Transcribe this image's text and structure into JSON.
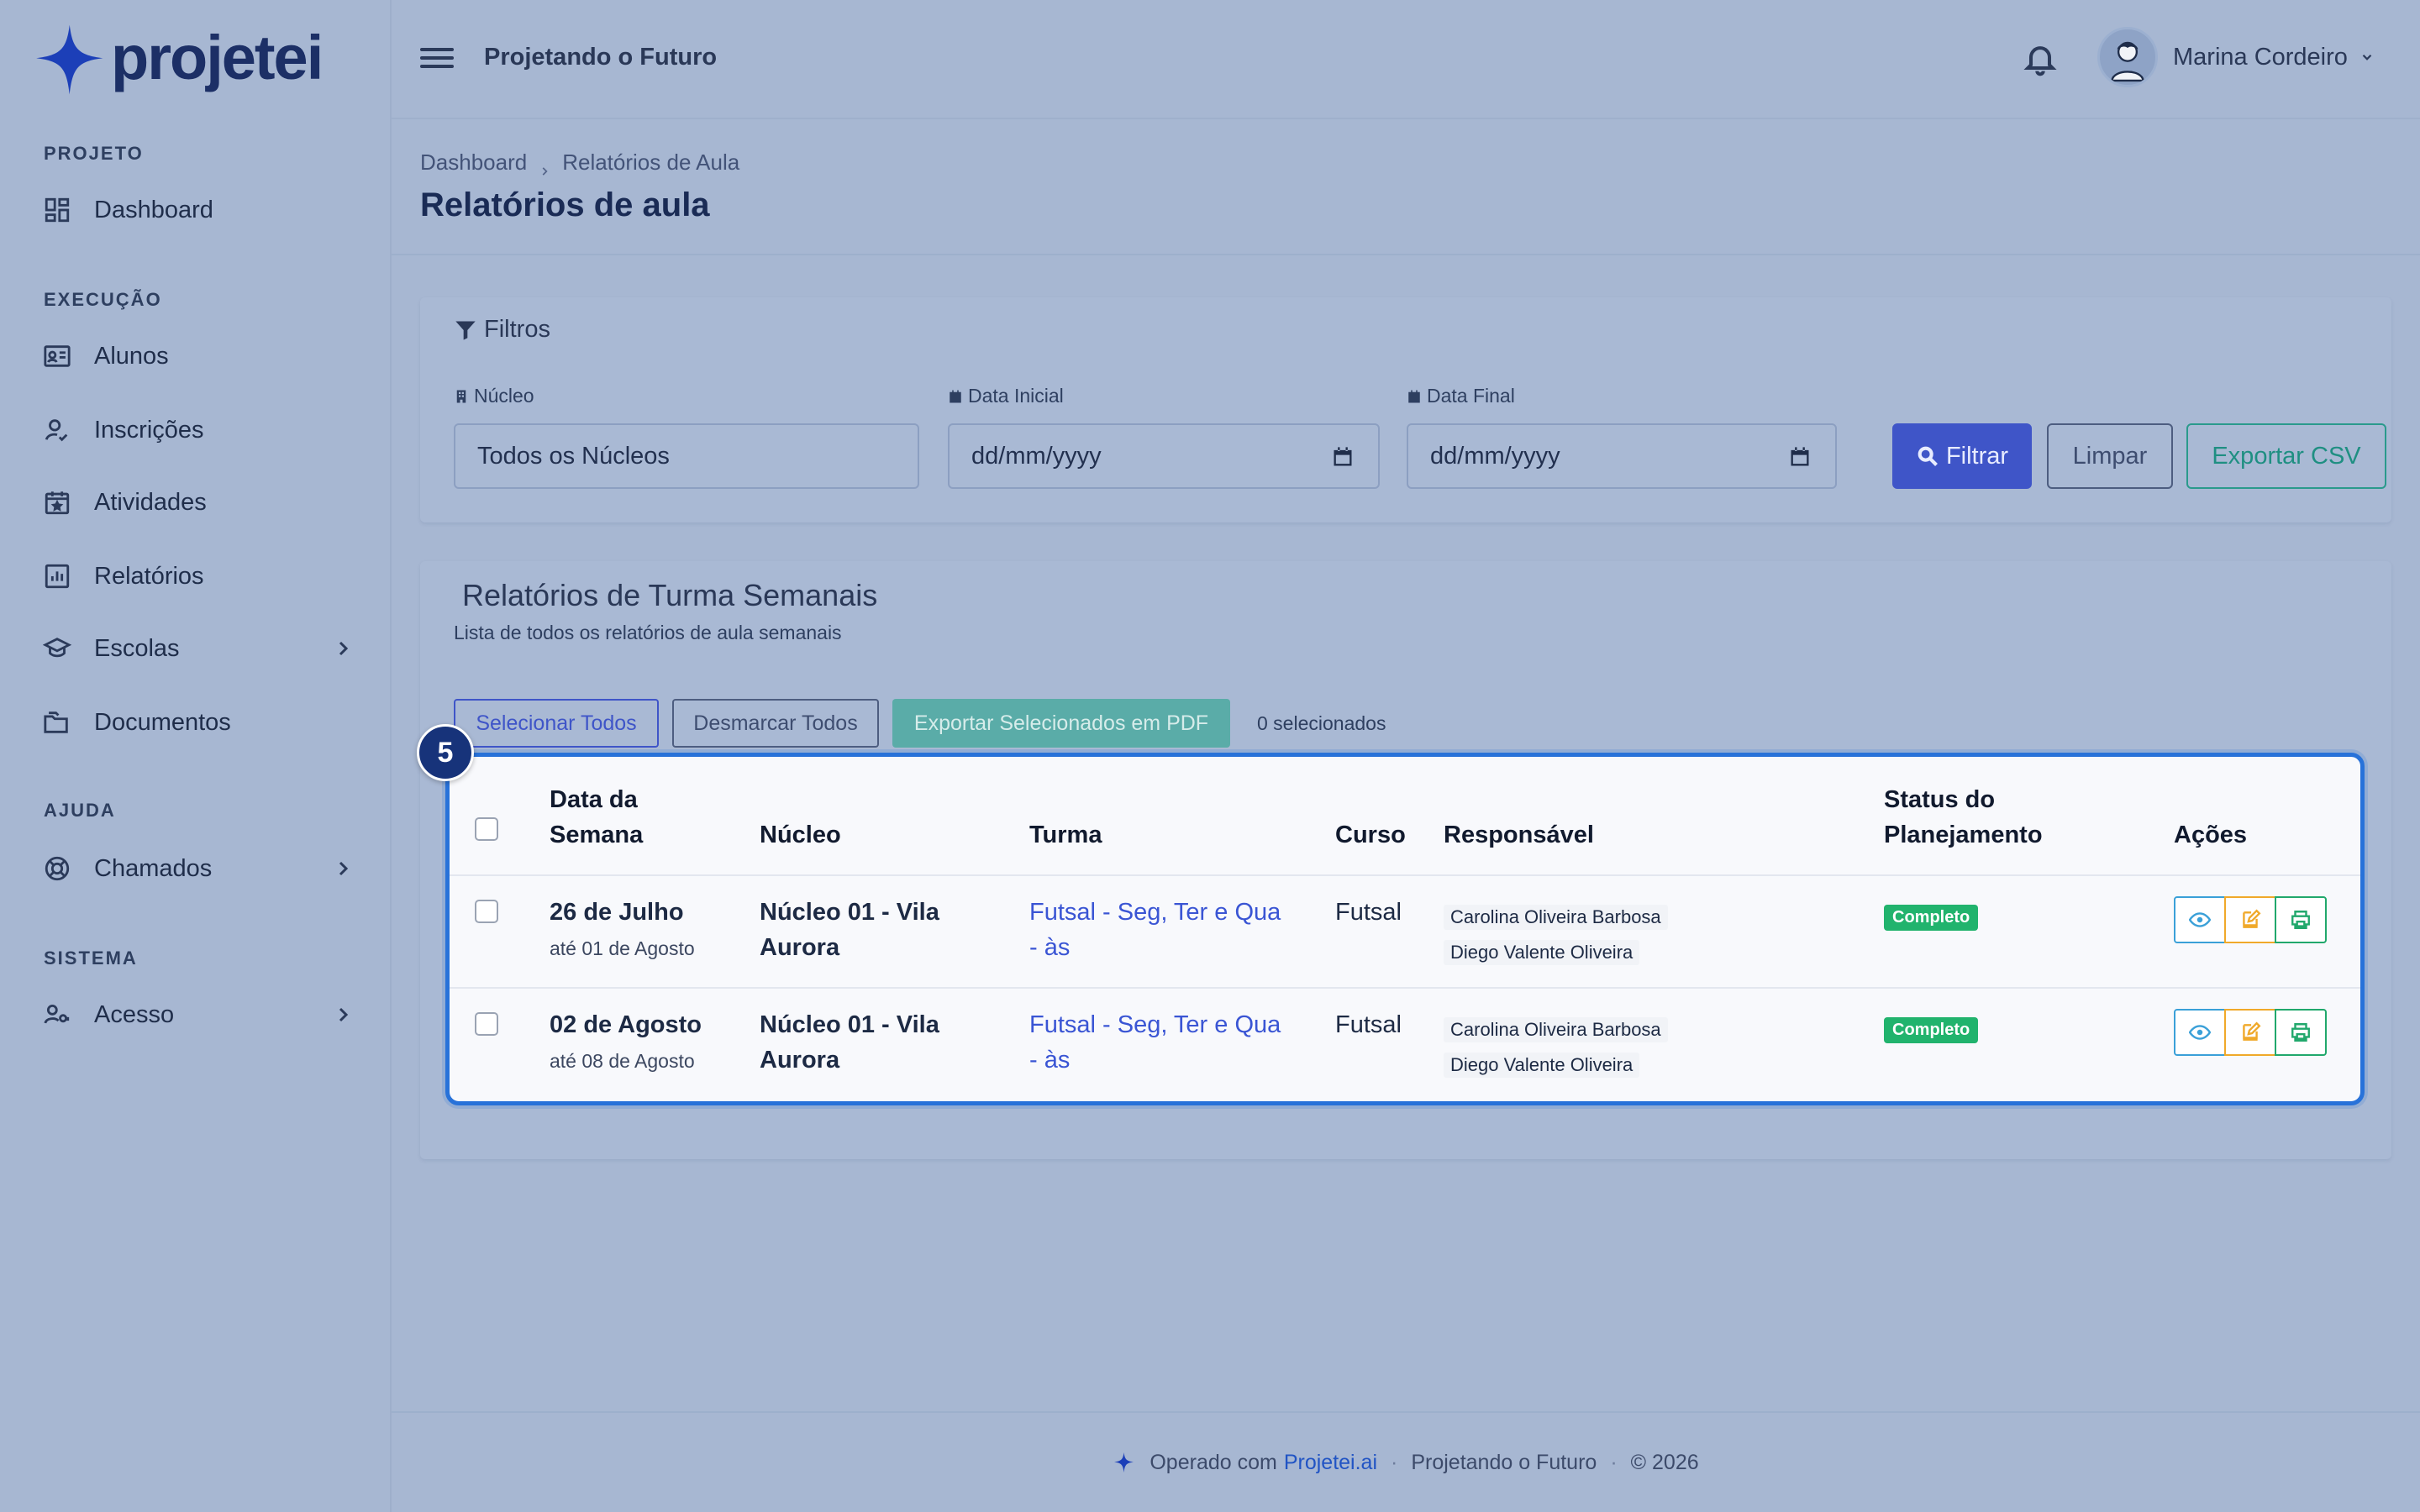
{
  "brand": {
    "name": "projetei",
    "accent": "#1c3fb8"
  },
  "sidebar": {
    "sections": [
      {
        "label": "PROJETO"
      },
      {
        "label": "EXECUÇÃO"
      },
      {
        "label": "AJUDA"
      },
      {
        "label": "SISTEMA"
      }
    ],
    "items": [
      {
        "label": "Dashboard",
        "icon": "dashboard-icon"
      },
      {
        "label": "Alunos",
        "icon": "id-card-icon"
      },
      {
        "label": "Inscrições",
        "icon": "user-check-icon"
      },
      {
        "label": "Atividades",
        "icon": "calendar-star-icon"
      },
      {
        "label": "Relatórios",
        "icon": "bar-chart-icon"
      },
      {
        "label": "Escolas",
        "icon": "graduation-cap-icon"
      },
      {
        "label": "Documentos",
        "icon": "folders-icon"
      },
      {
        "label": "Chamados",
        "icon": "lifebuoy-icon"
      },
      {
        "label": "Acesso",
        "icon": "user-key-icon"
      }
    ]
  },
  "header": {
    "org_name": "Projetando o Futuro",
    "user_name": "Marina Cordeiro"
  },
  "page": {
    "breadcrumb": [
      "Dashboard",
      "Relatórios de Aula"
    ],
    "title": "Relatórios de aula"
  },
  "filters": {
    "title": "Filtros",
    "nucleo_label": "Núcleo",
    "nucleo_value": "Todos os Núcleos",
    "data_inicial_label": "Data Inicial",
    "data_inicial_value": "dd/mm/yyyy",
    "data_final_label": "Data Final",
    "data_final_value": "dd/mm/yyyy",
    "filter_button": "Filtrar",
    "clear_button": "Limpar",
    "csv_button": "Exportar CSV"
  },
  "list": {
    "title": "Relatórios de Turma Semanais",
    "subtitle": "Lista de todos os relatórios de aula semanais",
    "select_all": "Selecionar Todos",
    "deselect_all": "Desmarcar Todos",
    "export_pdf": "Exportar Selecionados em PDF",
    "selected_count": "0 selecionados",
    "step_badge": "5",
    "columns": {
      "week_line1": "Data da",
      "week_line2": "Semana",
      "nucleo": "Núcleo",
      "turma": "Turma",
      "curso": "Curso",
      "responsavel": "Responsável",
      "status_line1": "Status do",
      "status_line2": "Planejamento",
      "acoes": "Ações"
    },
    "rows": [
      {
        "week": "26 de Julho",
        "week_end": "até 01 de Agosto",
        "nucleo_line1": "Núcleo 01 - Vila",
        "nucleo_line2": "Aurora",
        "turma_line1": "Futsal - Seg, Ter e Qua",
        "turma_line2": "- às",
        "curso": "Futsal",
        "responsavel1": "Carolina Oliveira Barbosa",
        "responsavel2": "Diego Valente Oliveira",
        "status": "Completo"
      },
      {
        "week": "02 de Agosto",
        "week_end": "até 08 de Agosto",
        "nucleo_line1": "Núcleo 01 - Vila",
        "nucleo_line2": "Aurora",
        "turma_line1": "Futsal - Seg, Ter e Qua",
        "turma_line2": "- às",
        "curso": "Futsal",
        "responsavel1": "Carolina Oliveira Barbosa",
        "responsavel2": "Diego Valente Oliveira",
        "status": "Completo"
      }
    ]
  },
  "footer": {
    "operated_with": "Operado com",
    "brand_link": "Projetei.ai",
    "org": "Projetando o Futuro",
    "copyright": "© 2026"
  }
}
